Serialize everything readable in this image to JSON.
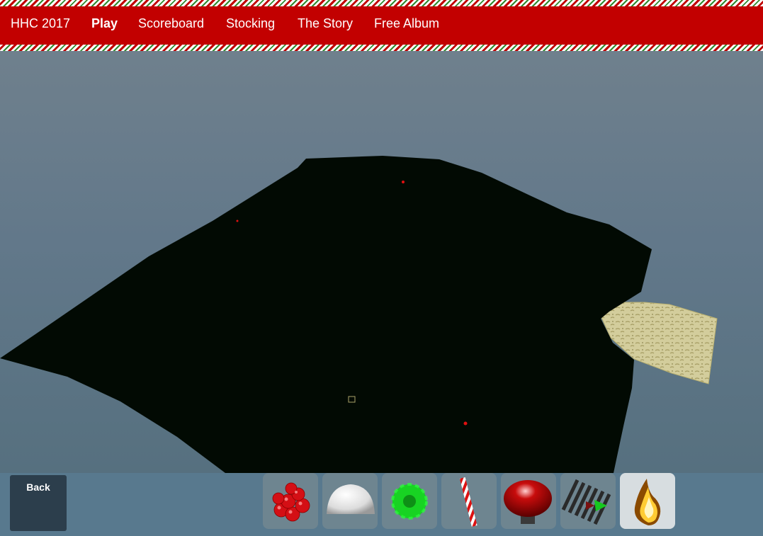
{
  "nav": {
    "brand": "HHC 2017",
    "items": [
      "Play",
      "Scoreboard",
      "Stocking",
      "The Story",
      "Free Album"
    ],
    "active": "Play"
  },
  "toolbar": {
    "back_label": "Back",
    "tools": [
      {
        "name": "red-ornament-cluster-icon"
      },
      {
        "name": "snow-dome-icon"
      },
      {
        "name": "green-wreath-icon"
      },
      {
        "name": "candy-cane-icon"
      },
      {
        "name": "mushroom-bumper-icon"
      },
      {
        "name": "conveyor-ramp-icon"
      },
      {
        "name": "fire-icon"
      }
    ]
  },
  "colors": {
    "nav_red": "#c20000",
    "terrain": "#020a03",
    "sand": "#d6d0a0",
    "toolbar": "#58798e"
  }
}
